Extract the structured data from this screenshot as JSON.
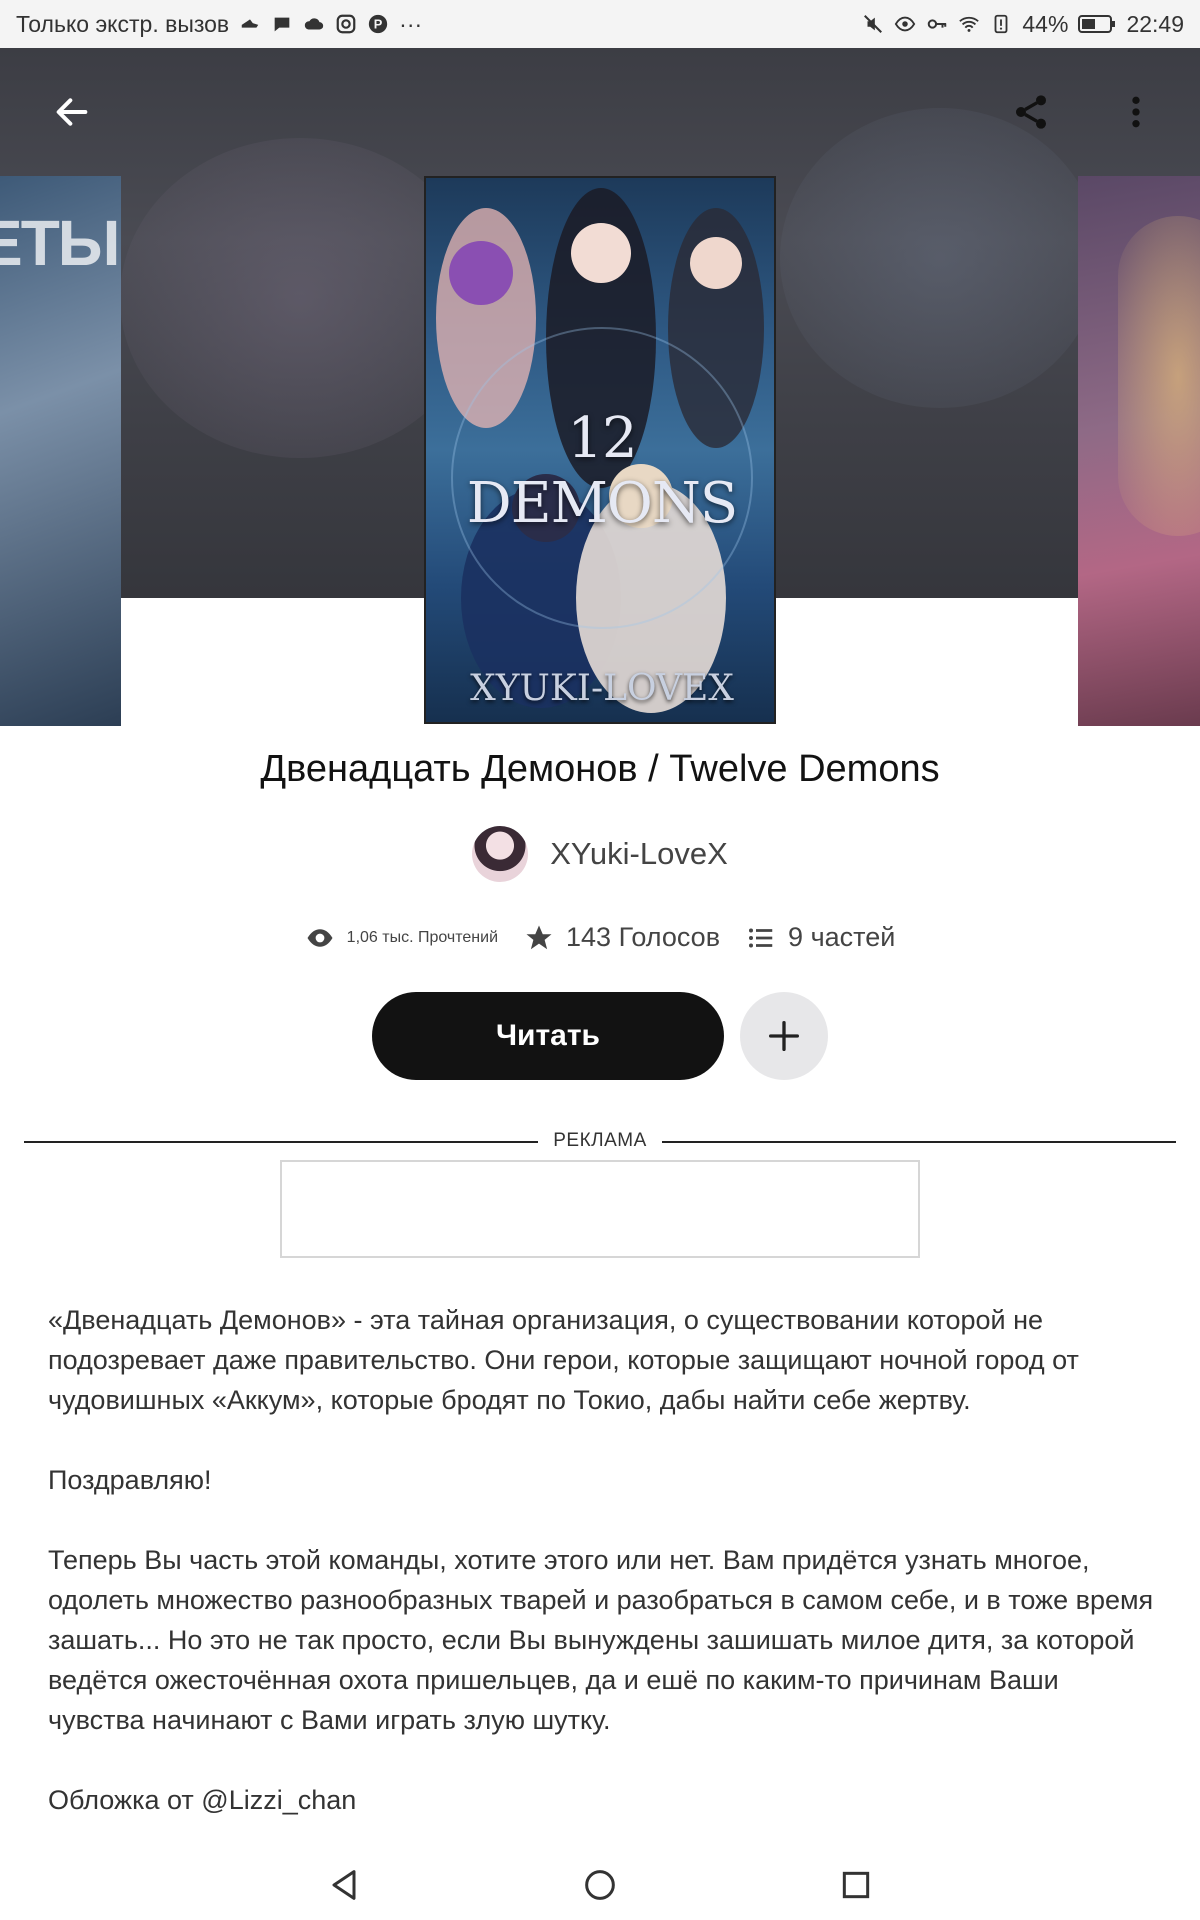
{
  "status_bar": {
    "carrier": "Только экстр. вызов",
    "extra": "···",
    "battery": "44%",
    "time": "22:49"
  },
  "story": {
    "title": "Двенадцать Демонов / Twelve Demons",
    "author": "XYuki-LoveX",
    "cover": {
      "title": "12 DEMONS",
      "author": "XYUKI-LOVEX"
    },
    "side_cover_left_text": "ЕТЫ"
  },
  "stats": {
    "reads": "1,06 тыс. Прочтений",
    "votes": "143 Голосов",
    "parts": "9 частей"
  },
  "actions": {
    "read": "Читать"
  },
  "ad": {
    "label": "РЕКЛАМА"
  },
  "description": [
    "«Двенадцать Демонов» - эта тайная организация, о существовании которой не подозревает даже правительство. Они герои, которые защищают ночной город от чудовишных «Аккум», которые бродят по Токио, дабы найти себе жертву.",
    "Поздравляю!",
    "Теперь Вы часть этой команды, хотите этого или нет. Вам придётся узнать многое, одолеть множество разнообразных тварей и разобраться в самом себе, и в тоже время зашать... Но это не так просто, если Вы вынуждены зашишать милое дитя, за которой ведётся ожесточённая охота пришельцев, да и ешё по каким-то причинам Ваши чувства начинают с Вами играть злую шутку.",
    "Обложка от @Lizzi_chan"
  ],
  "icons": {
    "back": "arrow-left-icon",
    "share": "share-icon",
    "more": "more-vertical-icon",
    "reads": "eye-icon",
    "votes": "star-icon",
    "parts": "list-icon",
    "add": "plus-icon"
  }
}
